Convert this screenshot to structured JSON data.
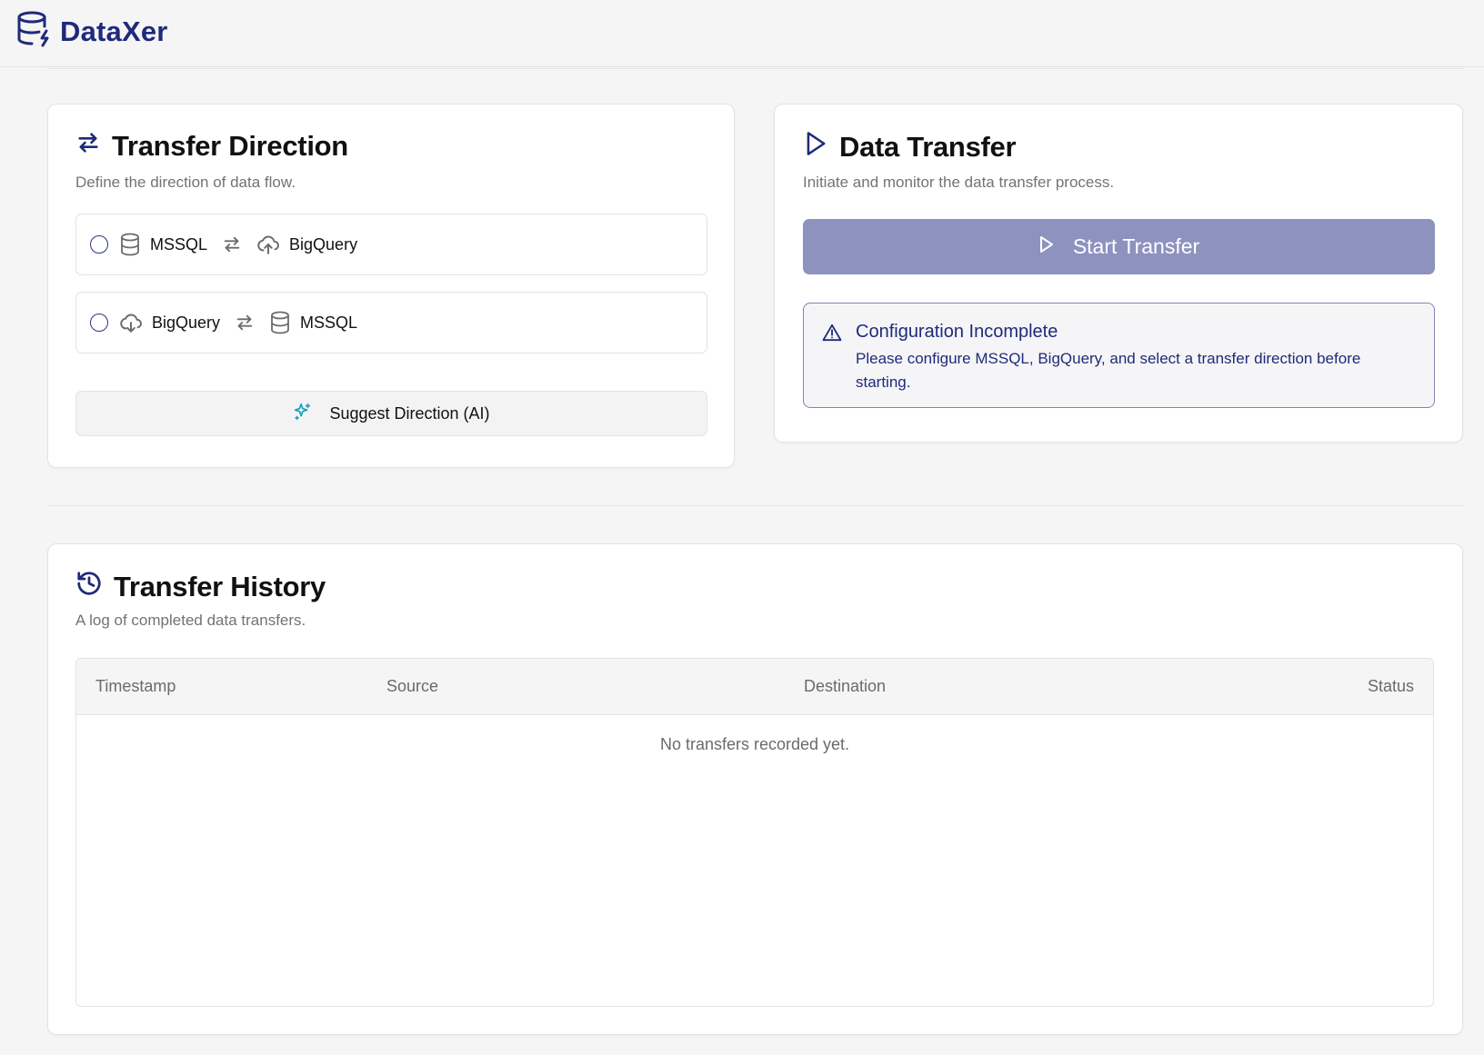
{
  "app": {
    "name": "DataXer",
    "brand_color": "#1f2a7a"
  },
  "direction_card": {
    "title": "Transfer Direction",
    "subtitle": "Define the direction of data flow.",
    "options": [
      {
        "from": "MSSQL",
        "to": "BigQuery",
        "from_icon": "database-icon",
        "to_icon": "cloud-upload-icon",
        "selected": false
      },
      {
        "from": "BigQuery",
        "to": "MSSQL",
        "from_icon": "cloud-download-icon",
        "to_icon": "database-icon",
        "selected": false
      }
    ],
    "suggest_label": "Suggest Direction (AI)",
    "suggest_icon_color": "#14a3b8"
  },
  "transfer_card": {
    "title": "Data Transfer",
    "subtitle": "Initiate and monitor the data transfer process.",
    "start_label": "Start Transfer",
    "start_color": "#8e92bf",
    "alert": {
      "title": "Configuration Incomplete",
      "message": "Please configure MSSQL, BigQuery, and select a transfer direction before starting."
    }
  },
  "history_card": {
    "title": "Transfer History",
    "subtitle": "A log of completed data transfers.",
    "columns": [
      "Timestamp",
      "Source",
      "Destination",
      "Status"
    ],
    "empty_message": "No transfers recorded yet."
  }
}
